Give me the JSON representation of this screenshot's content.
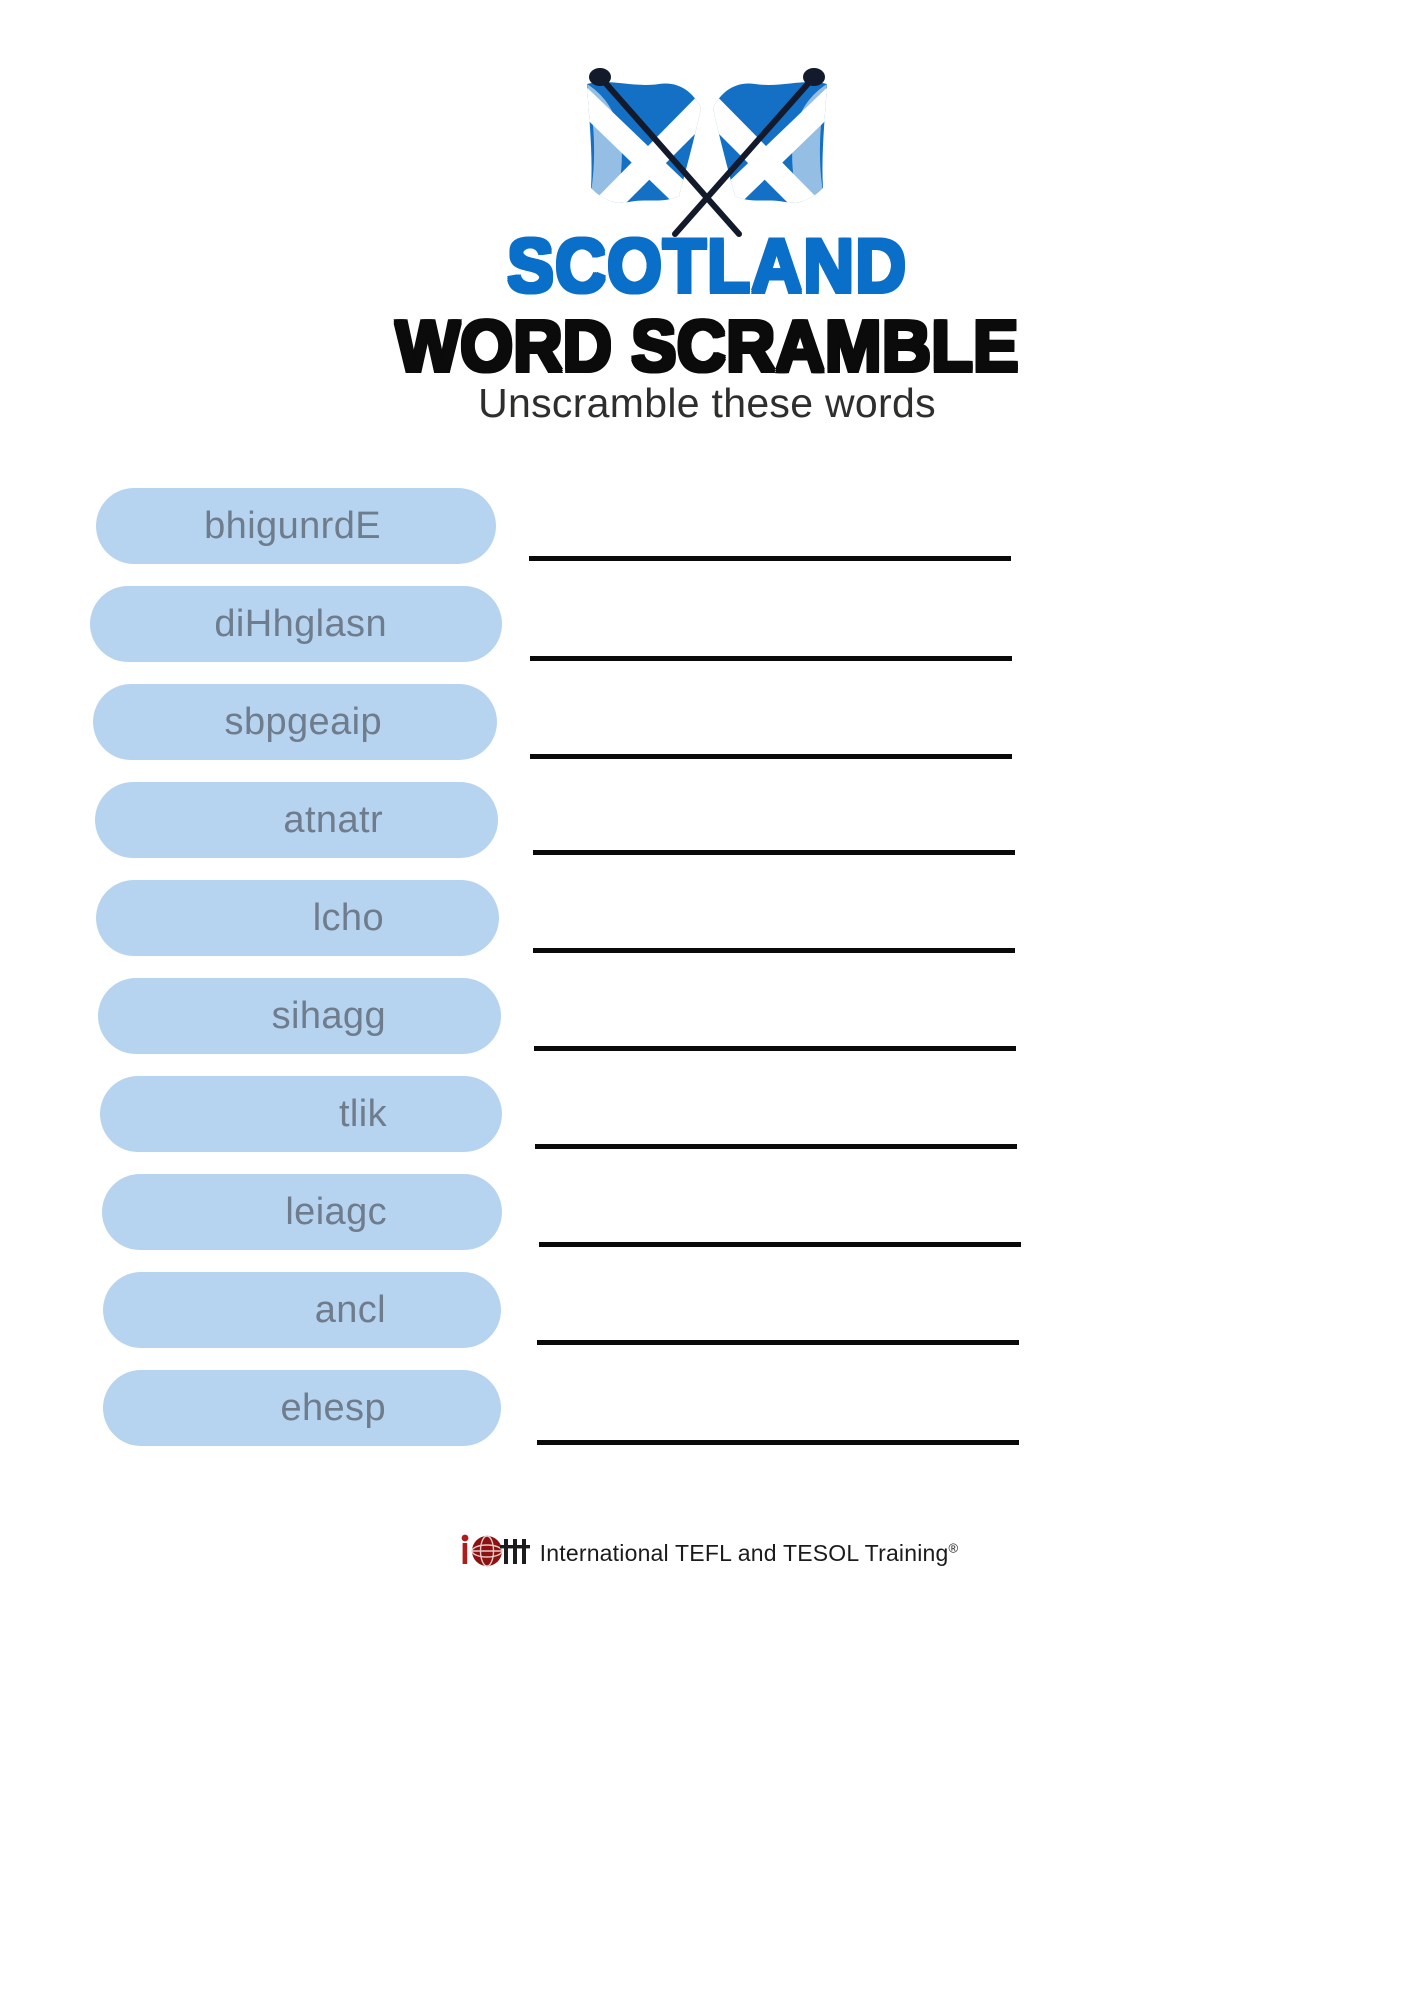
{
  "header": {
    "flag_emblem": "crossed-scotland-flags",
    "title_line1": "SCOTLAND",
    "title_line2": "WORD SCRAMBLE",
    "subtitle": "Unscramble these words",
    "title_color": "#0a6fc8",
    "subtitle_color": "#2e2e2c"
  },
  "worksheet": {
    "pill_color": "#b6d4f0",
    "pill_text_color": "#6f7c8c",
    "answer_line_color": "#0a0a0a",
    "words": [
      {
        "scrambled": "bhigunrdE"
      },
      {
        "scrambled": "diHhglasn"
      },
      {
        "scrambled": "sbpgeaip"
      },
      {
        "scrambled": "atnatr"
      },
      {
        "scrambled": "lcho"
      },
      {
        "scrambled": "sihagg"
      },
      {
        "scrambled": "tlik"
      },
      {
        "scrambled": "leiagc"
      },
      {
        "scrambled": "ancl"
      },
      {
        "scrambled": "ehesp"
      }
    ]
  },
  "footer": {
    "logo_name": "ittt-globe-logo",
    "brand": "International TEFL  and TESOL Training",
    "registered_mark": "®"
  }
}
